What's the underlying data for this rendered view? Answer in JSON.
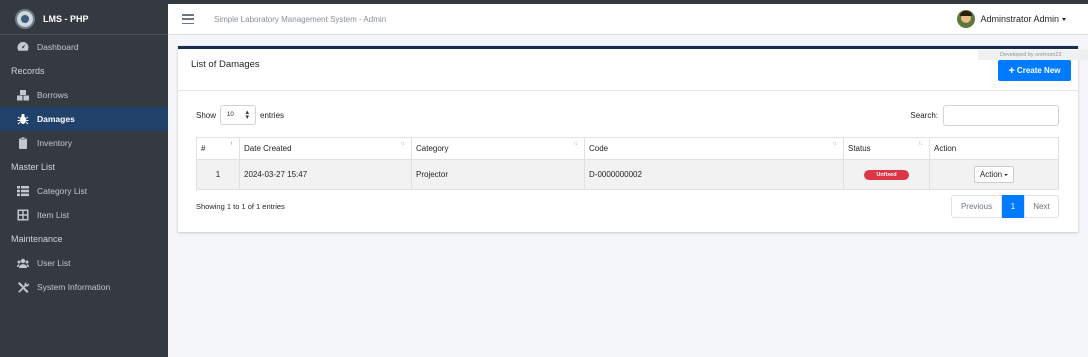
{
  "brand": {
    "title": "LMS - PHP"
  },
  "topbar": {
    "system_title": "Simple Laboratory Management System - Admin",
    "user_name": "Adminstrator Admin"
  },
  "sidebar": {
    "dashboard": "Dashboard",
    "records_header": "Records",
    "borrows": "Borrows",
    "damages": "Damages",
    "inventory": "Inventory",
    "master_header": "Master List",
    "category_list": "Category List",
    "item_list": "Item List",
    "maintenance_header": "Maintenance",
    "user_list": "User List",
    "system_information": "System Information"
  },
  "card": {
    "title": "List of Damages",
    "credit": "Developed by oretnom23",
    "create_button": "Create New",
    "show_label": "Show",
    "entries_value": "10",
    "entries_label": "entries",
    "search_label": "Search:"
  },
  "table": {
    "headers": [
      "#",
      "Date Created",
      "Category",
      "Code",
      "Status",
      "Action"
    ],
    "rows": [
      {
        "num": "1",
        "date": "2024-03-27 15:47",
        "category": "Projector",
        "code": "D-0000000002",
        "status": "Unfixed",
        "action": "Action"
      }
    ]
  },
  "footer": {
    "info": "Showing 1 to 1 of 1 entries",
    "prev": "Previous",
    "page": "1",
    "next": "Next"
  },
  "colors": {
    "sidebar": "#343a40",
    "active": "#20426a",
    "primary": "#007bff",
    "danger": "#dc3545",
    "card_top": "#1a2c52"
  }
}
